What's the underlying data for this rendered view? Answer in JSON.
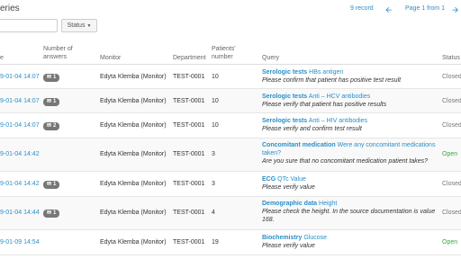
{
  "header": {
    "title": "eries",
    "record_count": "9 record",
    "page_label": "Page 1 from 1"
  },
  "filters": {
    "search_placeholder": "",
    "status_label": "Status"
  },
  "columns": {
    "date": "e",
    "answers": "Number of answers",
    "monitor": "Monitor",
    "department": "Department",
    "patient": "Patients' number",
    "query": "Query",
    "status": "Status"
  },
  "rows": [
    {
      "date": "9-01-04 14:07",
      "answers": "1",
      "monitor": "Edyta Klemba (Monitor)",
      "department": "TEST-0001",
      "patient": "10",
      "q_type": "Serologic tests",
      "q_subject": "HBs antigen",
      "q_text": "Please confirm that patient has positive test result",
      "status": "Closed"
    },
    {
      "date": "9-01-04 14:07",
      "answers": "1",
      "monitor": "Edyta Klemba (Monitor)",
      "department": "TEST-0001",
      "patient": "10",
      "q_type": "Serologic tests",
      "q_subject": "Anti – HCV antibodies",
      "q_text": "Please verify that patient has positive results",
      "status": "Closed"
    },
    {
      "date": "9-01-04 14:07",
      "answers": "2",
      "monitor": "Edyta Klemba (Monitor)",
      "department": "TEST-0001",
      "patient": "10",
      "q_type": "Serologic tests",
      "q_subject": "Anti – HIV antibodies",
      "q_text": "Please verify and confirm test result",
      "status": "Closed"
    },
    {
      "date": "9-01-04 14:42",
      "answers": "",
      "monitor": "Edyta Klemba (Monitor)",
      "department": "TEST-0001",
      "patient": "3",
      "q_type": "Concomitant medication",
      "q_subject": "Were any concomitant medications taken?",
      "q_text": "Are you sure that no concomitant medication patient takes?",
      "status": "Open"
    },
    {
      "date": "9-01-04 14:42",
      "answers": "1",
      "monitor": "Edyta Klemba (Monitor)",
      "department": "TEST-0001",
      "patient": "3",
      "q_type": "ECG",
      "q_subject": "QTc Value",
      "q_text": "Please verify value",
      "status": "Closed"
    },
    {
      "date": "9-01-04 14:44",
      "answers": "1",
      "monitor": "Edyta Klemba (Monitor)",
      "department": "TEST-0001",
      "patient": "4",
      "q_type": "Demographic data",
      "q_subject": "Height",
      "q_text": "Please check the height. In the source documentation is value 168.",
      "status": "Closed"
    },
    {
      "date": "9-01-09 14:54",
      "answers": "",
      "monitor": "Edyta Klemba (Monitor)",
      "department": "TEST-0001",
      "patient": "19",
      "q_type": "Biochemistry",
      "q_subject": "Glucose",
      "q_text": "Please verify value",
      "status": "Open"
    }
  ]
}
